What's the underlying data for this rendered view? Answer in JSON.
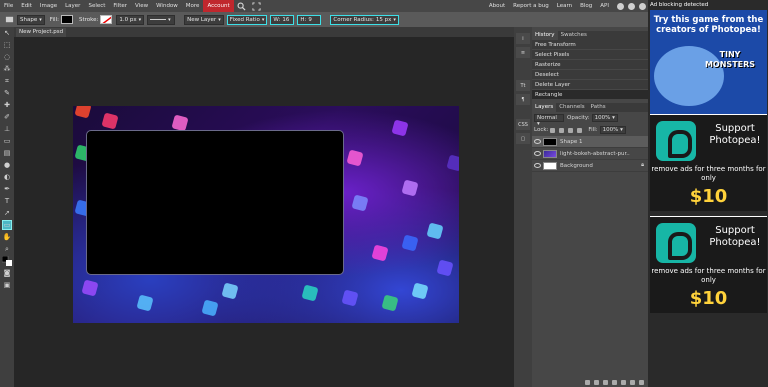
{
  "menu": {
    "items": [
      "File",
      "Edit",
      "Image",
      "Layer",
      "Select",
      "Filter",
      "View",
      "Window",
      "More"
    ],
    "account": "Account",
    "right": [
      "About",
      "Report a bug",
      "Learn",
      "Blog",
      "API"
    ]
  },
  "options": {
    "shape_mode": "Shape",
    "fill_label": "Fill:",
    "stroke_label": "Stroke:",
    "stroke_width": "1.0 px",
    "new_layer": "New Layer",
    "fixed_ratio": "Fixed Ratio",
    "w_label": "W:",
    "w_value": "16",
    "h_label": "H:",
    "h_value": "9",
    "corner_radius": "Corner Radius:",
    "corner_value": "15 px"
  },
  "doc_tab": "New Project.psd *",
  "panels": {
    "history_tabs": [
      "History",
      "Swatches"
    ],
    "history_items": [
      "Free Transform",
      "Select Pixels",
      "Rasterize",
      "Deselect",
      "Delete Layer",
      "Rectangle"
    ],
    "layers_tabs": [
      "Layers",
      "Channels",
      "Paths"
    ],
    "blend_mode": "Normal",
    "opacity_label": "Opacity:",
    "opacity_value": "100%",
    "lock_label": "Lock:",
    "fill_label": "Fill:",
    "fill_value": "100%",
    "layers": [
      "Shape 1",
      "light-bokeh-abstract-pur..",
      "Background"
    ]
  },
  "strip": [
    "i",
    "≡",
    "Tt",
    "¶",
    "CSS",
    "▢"
  ],
  "ad": {
    "label": "Ad blocking detected",
    "game_title": "Try this game from the creators of Photopea!",
    "game_logo": "TINY MONSTERS",
    "support_title": "Support Photopea!",
    "support_text": "remove ads for three months for only",
    "price": "$10"
  },
  "colors": {
    "accent": "#3de0e8",
    "account": "#c0272d",
    "price": "#ffd23b"
  }
}
